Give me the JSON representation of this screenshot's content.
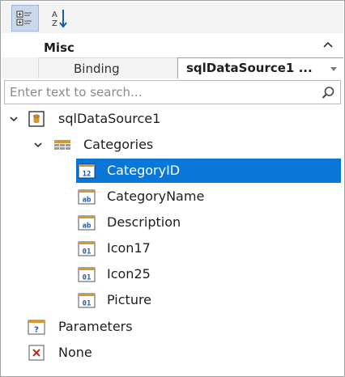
{
  "toolbar": {
    "categorized_icon": "categorized-view-icon",
    "alphabetical_icon": "sort-alphabetical-icon"
  },
  "property_grid": {
    "category": "Misc",
    "property_name": "Binding",
    "property_value": "sqlDataSource1 ..."
  },
  "search": {
    "placeholder": "Enter text to search...",
    "value": ""
  },
  "tree": {
    "root": {
      "label": "sqlDataSource1",
      "icon": "database-icon",
      "expanded": true
    },
    "table": {
      "label": "Categories",
      "icon": "table-icon",
      "expanded": true
    },
    "fields": [
      {
        "label": "CategoryID",
        "badge": "12",
        "type": "numeric",
        "selected": true
      },
      {
        "label": "CategoryName",
        "badge": "ab",
        "type": "string",
        "selected": false
      },
      {
        "label": "Description",
        "badge": "ab",
        "type": "string",
        "selected": false
      },
      {
        "label": "Icon17",
        "badge": "01",
        "type": "binary",
        "selected": false
      },
      {
        "label": "Icon25",
        "badge": "01",
        "type": "binary",
        "selected": false
      },
      {
        "label": "Picture",
        "badge": "01",
        "type": "binary",
        "selected": false
      }
    ],
    "parameters": {
      "label": "Parameters",
      "badge": "?",
      "icon": "parameters-icon"
    },
    "none": {
      "label": "None",
      "badge": "✕",
      "icon": "none-icon"
    }
  },
  "colors": {
    "selection": "#0a76d8",
    "field_badge_accent": "#c6922f",
    "field_badge_text": "#1e5ba8",
    "none_icon": "#c42b1c"
  }
}
